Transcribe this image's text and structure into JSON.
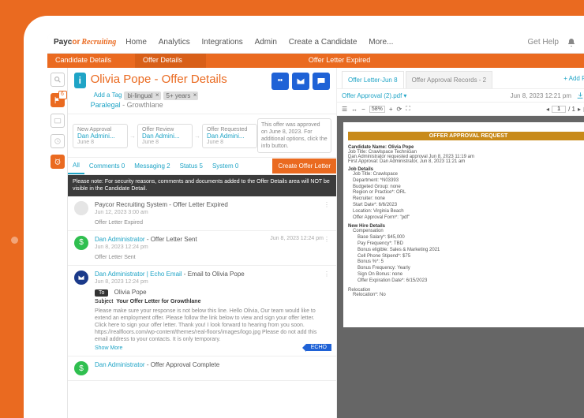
{
  "nav": {
    "home": "Home",
    "analytics": "Analytics",
    "integrations": "Integrations",
    "admin": "Admin",
    "create": "Create a Candidate",
    "more": "More...",
    "help": "Get Help"
  },
  "brand": {
    "p": "Payc",
    "or": "or",
    "r": "Recruiting"
  },
  "tabs": {
    "cand": "Candidate Details",
    "offer": "Offer Details",
    "expired": "Offer Letter Expired"
  },
  "title": {
    "name": "Olivia Pope - Offer Details",
    "addtag": "Add a Tag",
    "tag1": "bi-lingual",
    "tag2": "5+ years",
    "role": "Paralegal",
    "co": " - Growthlane"
  },
  "stages": [
    {
      "lbl": "New Approval",
      "who": "Dan Admini...",
      "dt": "June 8"
    },
    {
      "lbl": "Offer Review",
      "who": "Dan Admini...",
      "dt": "June 8"
    },
    {
      "lbl": "Offer Requested",
      "who": "Dan Admini...",
      "dt": "June 8"
    }
  ],
  "approved": "This offer was approved on June 8, 2023. For additional options, click the info button.",
  "subtabs": {
    "all": "All",
    "comments": "Comments 0",
    "messaging": "Messaging 2",
    "status": "Status 5",
    "system": "System 0",
    "create": "Create Offer Letter"
  },
  "warning": "Please note: For security reasons, comments and documents added to the Offer Details area will NOT be visible in the Candidate Detail.",
  "feed": [
    {
      "head1": "Paycor Recruiting System",
      "head2": " - Offer Letter Expired",
      "dt": "Jun 12, 2023 3:00 am",
      "sub": "Offer Letter Expired"
    },
    {
      "head1": "Dan Administrator",
      "head2": " - Offer Letter Sent",
      "dt": "Jun 8, 2023 12:24 pm",
      "sub": "Offer Letter Sent",
      "time": "Jun 8, 2023 12:24 pm"
    },
    {
      "head1": "Dan Administrator | Echo Email",
      "head2": " - Email to Olivia Pope",
      "dt": "Jun 8, 2023 12:24 pm",
      "to": "To",
      "name": "Olivia Pope",
      "subjlbl": "Subject",
      "subj": "Your Offer Letter for Growthlane",
      "body": "Please make sure your response is not below this line. Hello Olivia, Our team would like to extend an employment offer. Please follow the link below to view and sign your offer letter. Click here to sign your offer letter. Thank you! I look forward to hearing from you soon. https://realfloors.com/wp-content/themes/real-floors/images/logo.jpg Please do not add this email address to your contacts. It is only temporary.",
      "more": "Show More",
      "echo": "ECHO"
    },
    {
      "head1": "Dan Administrator",
      "head2": " - Offer Approval Complete"
    }
  ],
  "rtabs": {
    "t1": "Offer Letter-Jun 8",
    "t2": "Offer Approval Records - 2",
    "add": "+ Add File"
  },
  "rfile": {
    "name": "Offer Approval (2).pdf",
    "dt": "Jun 8, 2023 12:21 pm"
  },
  "pdftb": {
    "zoom": "58%",
    "pg": "1",
    "pgs": "/ 1"
  },
  "pdf": {
    "banner": "OFFER APPROVAL REQUEST",
    "cand_lbl": "Candidate Name: ",
    "cand": "Olivia Pope",
    "jt_lbl": "Job Title: ",
    "jt": "Crawlspace Technician",
    "l1": "Dan Administrator requested approval Jun 8, 2023 11:19 am",
    "l2": "First Approval: Dan Administrator, Jun 8, 2023 11:21 am",
    "jd": "Job Details",
    "jd1": "Job Title: Crawlspace",
    "jd2": "Department: *N03393",
    "jd3": "Budgeted Group: none",
    "jd4": "Region or Practice*: ORL",
    "jd5": "Recruiter: none",
    "jd6": "Start Date*: 6/6/2023",
    "jd7": "Location: Virginia Beach",
    "jd8": "Offer Approval Form*: \"pdf\"",
    "nh": "New Hire Details",
    "comp": "Compensation",
    "c1": "Base Salary*: $45,000",
    "c2": "Pay Frequency*: TBD",
    "c3": "Bonus eligible: Sales & Marketing 2021",
    "c4": "Cell Phone Stipend*: $75",
    "c5": "Bonus %*: 5",
    "c6": "Bonus Frequency: Yearly",
    "c7": "Sign On Bonus: none",
    "c8": "Offer Expiration Date*: 6/15/2023",
    "rel": "Relocation",
    "r1": "Relocation*: No"
  }
}
